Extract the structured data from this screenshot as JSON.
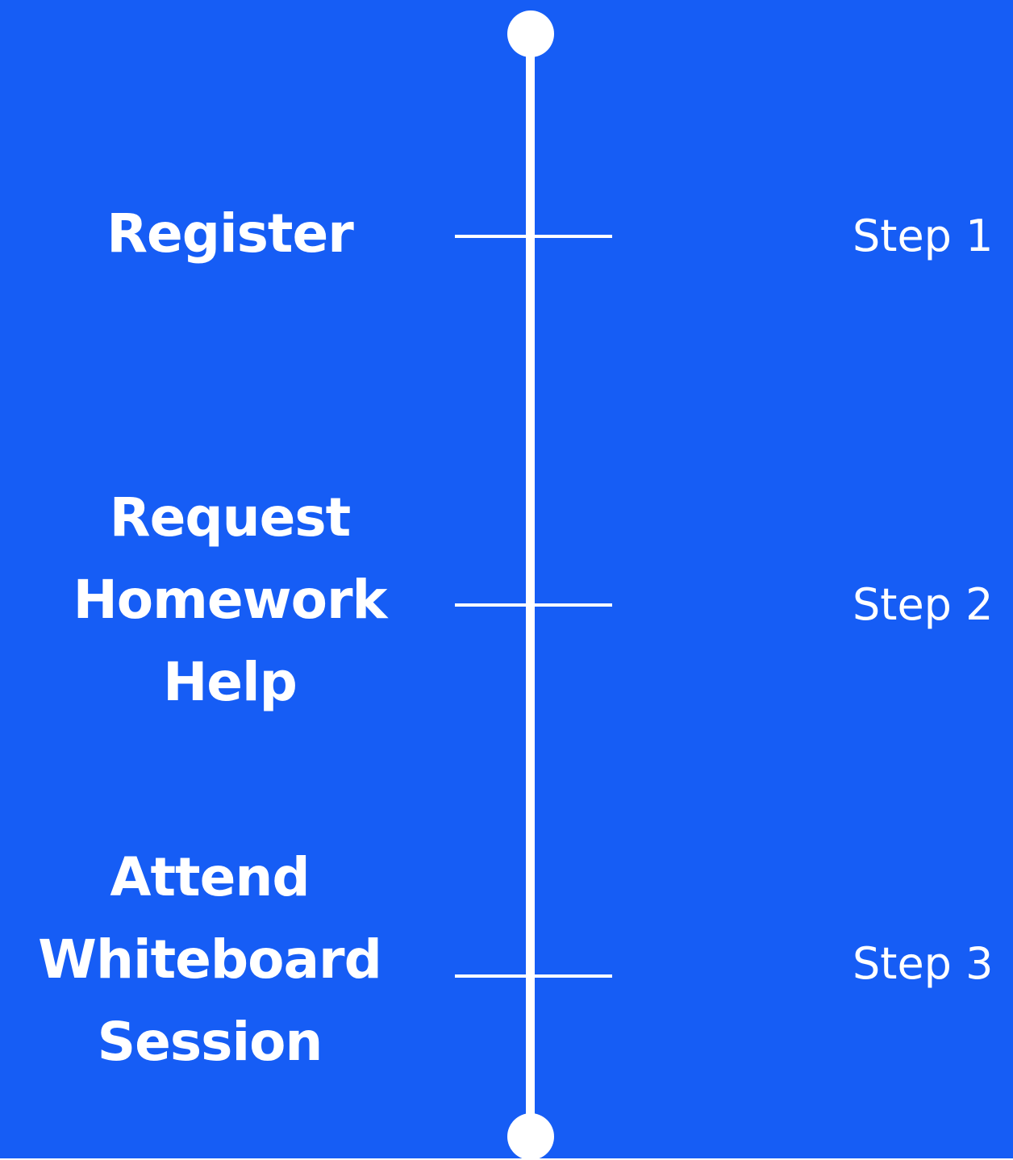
{
  "colors": {
    "background": "#165df5",
    "foreground": "#ffffff"
  },
  "timeline": {
    "steps": [
      {
        "title_lines": [
          "Register"
        ],
        "label": "Step 1"
      },
      {
        "title_lines": [
          "Request",
          "Homework",
          "Help"
        ],
        "label": "Step 2"
      },
      {
        "title_lines": [
          "Attend",
          "Whiteboard",
          "Session"
        ],
        "label": "Step 3"
      }
    ]
  }
}
